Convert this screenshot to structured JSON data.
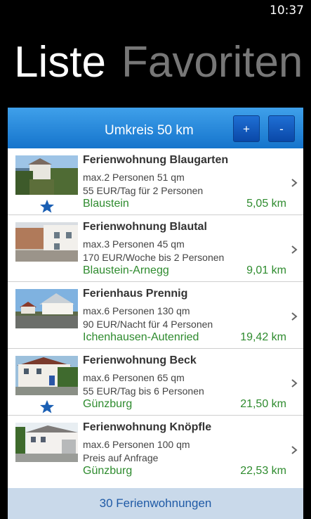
{
  "status": {
    "time": "10:37"
  },
  "pivot": {
    "active": "Liste",
    "inactive": "Favoriten"
  },
  "header": {
    "title": "Umkreis 50 km",
    "plus_label": "+",
    "minus_label": "-"
  },
  "items": [
    {
      "title": "Ferienwohnung  Blaugarten",
      "persons": "max.2 Personen 51 qm",
      "price": "55 EUR/Tag für 2 Personen",
      "place": "Blaustein",
      "distance": "5,05 km",
      "favorite": true
    },
    {
      "title": "Ferienwohnung Blautal",
      "persons": "max.3 Personen 45 qm",
      "price": "170 EUR/Woche bis 2 Personen",
      "place": "Blaustein-Arnegg",
      "distance": "9,01 km",
      "favorite": false
    },
    {
      "title": "Ferienhaus Prennig",
      "persons": "max.6 Personen 130 qm",
      "price": "90 EUR/Nacht für 4 Personen",
      "place": "Ichenhausen-Autenried",
      "distance": "19,42 km",
      "favorite": false
    },
    {
      "title": "Ferienwohnung Beck",
      "persons": "max.6 Personen 65 qm",
      "price": "55 EUR/Tag bis 6 Personen",
      "place": "Günzburg",
      "distance": "21,50 km",
      "favorite": true
    },
    {
      "title": "Ferienwohnung Knöpfle",
      "persons": "max.6 Personen 100 qm",
      "price": "Preis auf Anfrage",
      "place": "Günzburg",
      "distance": "22,53 km",
      "favorite": false
    }
  ],
  "footer": {
    "count_label": "30 Ferienwohnungen"
  },
  "colors": {
    "accent": "#1f7fd6",
    "place_green": "#2e8b2e",
    "star_blue": "#1a5fb4",
    "footer_bg": "#c9d9ea"
  }
}
